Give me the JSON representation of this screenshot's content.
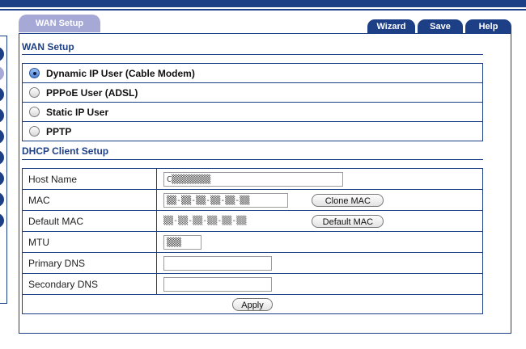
{
  "header": {
    "tab_label": "WAN Setup",
    "buttons": {
      "wizard": "Wizard",
      "save": "Save",
      "help": "Help"
    }
  },
  "wan_setup": {
    "title": "WAN Setup",
    "options": [
      {
        "label": "Dynamic IP User (Cable Modem)",
        "selected": true
      },
      {
        "label": "PPPoE User (ADSL)",
        "selected": false
      },
      {
        "label": "Static IP User",
        "selected": false
      },
      {
        "label": "PPTP",
        "selected": false
      }
    ]
  },
  "dhcp": {
    "title": "DHCP Client Setup",
    "host_name": {
      "label": "Host Name",
      "value": "C▒▒▒▒▒▒▒▒"
    },
    "mac": {
      "label": "MAC",
      "value": "▒▒-▒▒-▒▒-▒▒-▒▒-▒▒",
      "button": "Clone   MAC"
    },
    "default_mac": {
      "label": "Default MAC",
      "value": "▒▒-▒▒-▒▒-▒▒-▒▒-▒▒",
      "button": "Default MAC"
    },
    "mtu": {
      "label": "MTU",
      "value": "▒▒▒"
    },
    "primary_dns": {
      "label": "Primary DNS",
      "value": ""
    },
    "secondary_dns": {
      "label": "Secondary DNS",
      "value": ""
    },
    "apply_button": "Apply"
  },
  "colors": {
    "brand": "#1d3f86",
    "tab": "#a6a8d6"
  }
}
